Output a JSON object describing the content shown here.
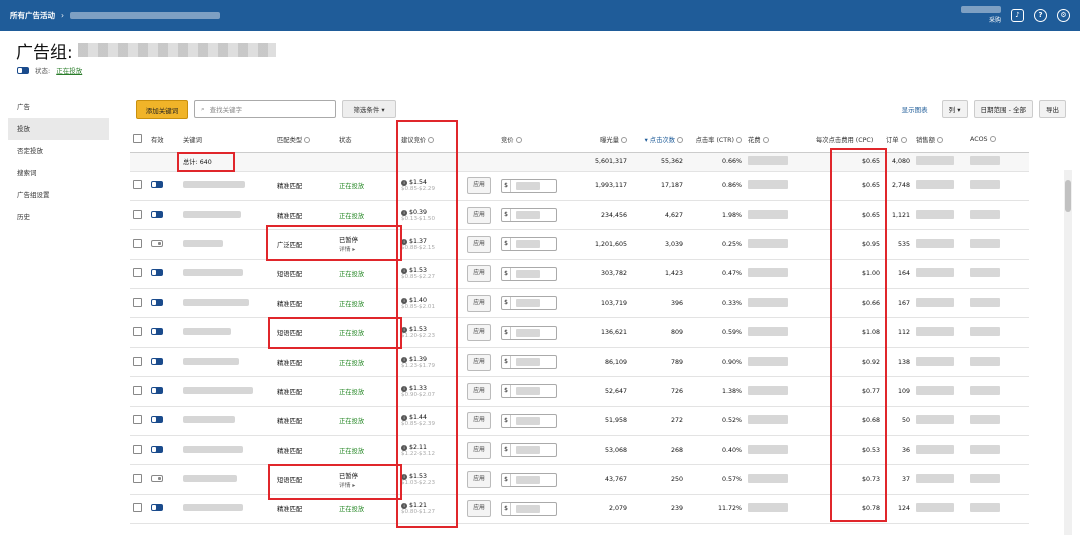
{
  "topbar": {
    "breadcrumb_root": "所有广告活动",
    "breadcrumb_sep": "›",
    "user_initial": "采购",
    "icons": [
      "bell-icon",
      "help-icon",
      "settings-icon"
    ]
  },
  "header": {
    "title_prefix": "广告组:",
    "status_label": "状态:",
    "status_value": "正在投放"
  },
  "sidebar": {
    "items": [
      {
        "label": "广告",
        "active": false
      },
      {
        "label": "投放",
        "active": true
      },
      {
        "label": "否定投放",
        "active": false
      },
      {
        "label": "搜索词",
        "active": false
      },
      {
        "label": "广告组设置",
        "active": false
      },
      {
        "label": "历史",
        "active": false
      }
    ]
  },
  "toolbar": {
    "add_label": "添加关键词",
    "search_placeholder": "查找关键字",
    "filter_label": "筛选条件 ▾",
    "chart_link": "显示图表",
    "columns_label": "列 ▾",
    "date_label": "日期范围 - 全部",
    "export_label": "导出"
  },
  "table": {
    "headers": {
      "active": "有效",
      "keyword": "关键词",
      "match": "匹配类型",
      "status": "状态",
      "suggested": "建议竞价",
      "bid": "竞价",
      "impressions": "曝光量",
      "clicks": "▾ 点击次数",
      "ctr": "点击率 (CTR)",
      "spend": "花费",
      "cpc": "每次点击费用 (CPC)",
      "orders": "订单",
      "sales": "销售额",
      "acos": "ACOS"
    },
    "total": {
      "label": "总计: 640",
      "impressions": "5,601,317",
      "clicks": "55,362",
      "ctr": "0.66%",
      "cpc": "$0.65",
      "orders": "4,080"
    },
    "apply_label": "应用",
    "currency": "$",
    "rows": [
      {
        "active": true,
        "match": "精准匹配",
        "status": "正在投放",
        "status_detail": "",
        "sbid": "$1.54",
        "srange": "$0.85-$2.29",
        "impressions": "1,993,117",
        "clicks": "17,187",
        "ctr": "0.86%",
        "cpc": "$0.65",
        "orders": "2,748"
      },
      {
        "active": true,
        "match": "精准匹配",
        "status": "正在投放",
        "status_detail": "",
        "sbid": "$0.39",
        "srange": "$0.13-$1.50",
        "impressions": "234,456",
        "clicks": "4,627",
        "ctr": "1.98%",
        "cpc": "$0.65",
        "orders": "1,121"
      },
      {
        "active": false,
        "match": "广泛匹配",
        "status": "已暂停",
        "status_detail": "详情 ▸",
        "sbid": "$1.37",
        "srange": "$0.88-$2.15",
        "impressions": "1,201,605",
        "clicks": "3,039",
        "ctr": "0.25%",
        "cpc": "$0.95",
        "orders": "535"
      },
      {
        "active": true,
        "match": "短语匹配",
        "status": "正在投放",
        "status_detail": "",
        "sbid": "$1.53",
        "srange": "$0.85-$2.27",
        "impressions": "303,782",
        "clicks": "1,423",
        "ctr": "0.47%",
        "cpc": "$1.00",
        "orders": "164"
      },
      {
        "active": true,
        "match": "精准匹配",
        "status": "正在投放",
        "status_detail": "",
        "sbid": "$1.40",
        "srange": "$0.85-$2.01",
        "impressions": "103,719",
        "clicks": "396",
        "ctr": "0.33%",
        "cpc": "$0.66",
        "orders": "167"
      },
      {
        "active": true,
        "match": "短语匹配",
        "status": "正在投放",
        "status_detail": "",
        "sbid": "$1.53",
        "srange": "$1.20-$2.23",
        "impressions": "136,621",
        "clicks": "809",
        "ctr": "0.59%",
        "cpc": "$1.08",
        "orders": "112"
      },
      {
        "active": true,
        "match": "精准匹配",
        "status": "正在投放",
        "status_detail": "",
        "sbid": "$1.39",
        "srange": "$1.23-$1.79",
        "impressions": "86,109",
        "clicks": "789",
        "ctr": "0.90%",
        "cpc": "$0.92",
        "orders": "138"
      },
      {
        "active": true,
        "match": "精准匹配",
        "status": "正在投放",
        "status_detail": "",
        "sbid": "$1.33",
        "srange": "$0.90-$2.07",
        "impressions": "52,647",
        "clicks": "726",
        "ctr": "1.38%",
        "cpc": "$0.77",
        "orders": "109"
      },
      {
        "active": true,
        "match": "精准匹配",
        "status": "正在投放",
        "status_detail": "",
        "sbid": "$1.44",
        "srange": "$0.85-$2.39",
        "impressions": "51,958",
        "clicks": "272",
        "ctr": "0.52%",
        "cpc": "$0.68",
        "orders": "50"
      },
      {
        "active": true,
        "match": "精准匹配",
        "status": "正在投放",
        "status_detail": "",
        "sbid": "$2.11",
        "srange": "$1.22-$3.12",
        "impressions": "53,068",
        "clicks": "268",
        "ctr": "0.40%",
        "cpc": "$0.53",
        "orders": "36"
      },
      {
        "active": false,
        "match": "短语匹配",
        "status": "已暂停",
        "status_detail": "详情 ▸",
        "sbid": "$1.53",
        "srange": "$1.03-$2.23",
        "impressions": "43,767",
        "clicks": "250",
        "ctr": "0.57%",
        "cpc": "$0.73",
        "orders": "37"
      },
      {
        "active": true,
        "match": "精准匹配",
        "status": "正在投放",
        "status_detail": "",
        "sbid": "$1.21",
        "srange": "$0.80-$1.27",
        "impressions": "2,079",
        "clicks": "239",
        "ctr": "11.72%",
        "cpc": "$0.78",
        "orders": "124"
      }
    ]
  }
}
